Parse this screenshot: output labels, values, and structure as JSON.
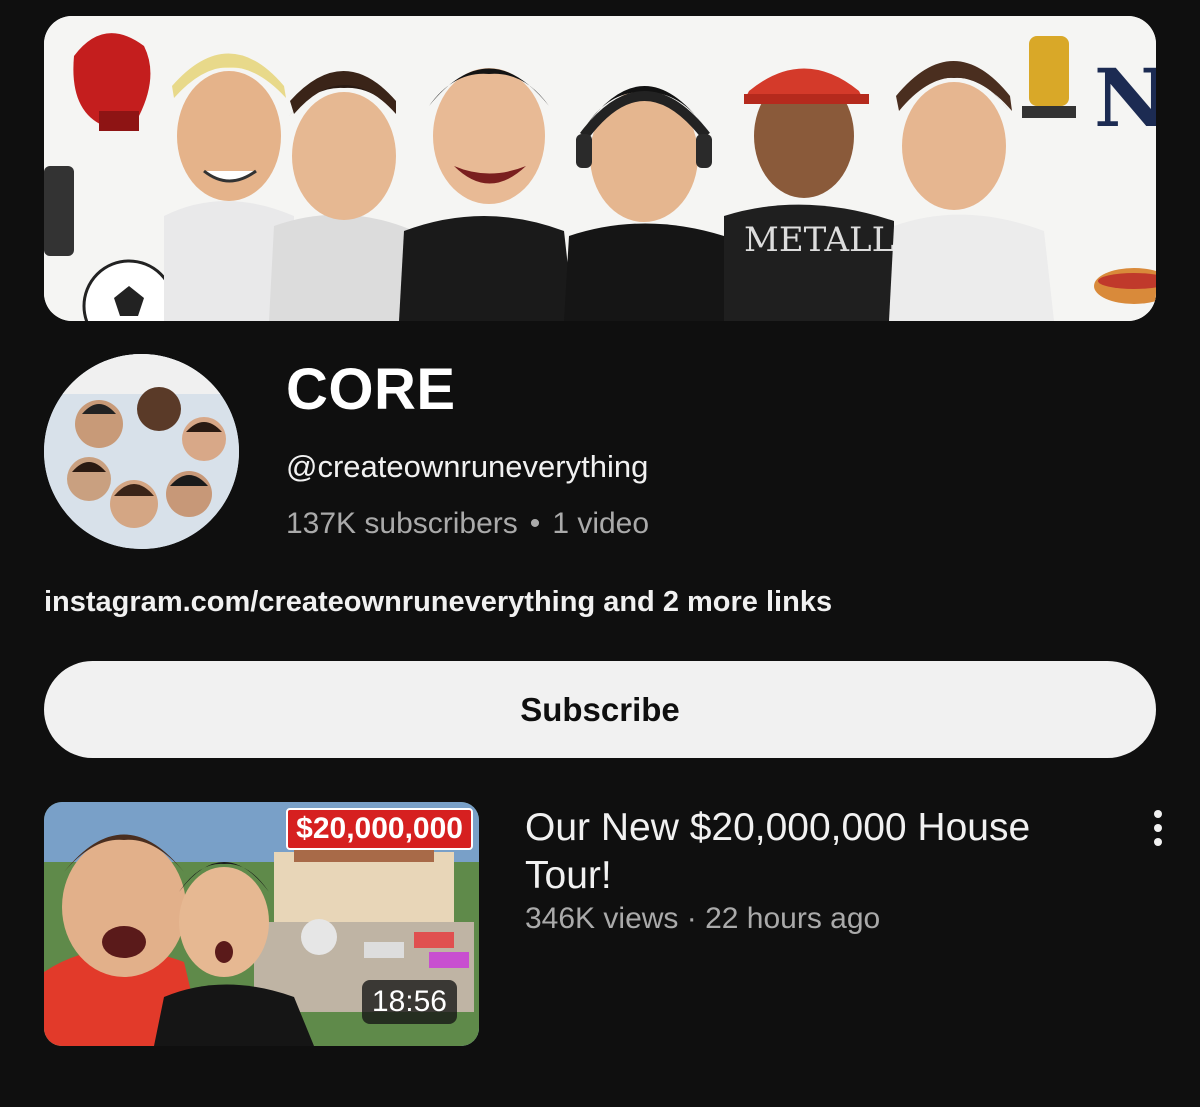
{
  "channel": {
    "name": "CORE",
    "handle": "@createownruneverything",
    "subscribers": "137K subscribers",
    "separator": "•",
    "video_count": "1 video",
    "links_text": "instagram.com/createownruneverything and 2 more links",
    "banner_icon": "channel-banner-art",
    "avatar_icon": "channel-avatar-photo"
  },
  "actions": {
    "subscribe_label": "Subscribe"
  },
  "videos": [
    {
      "title": "Our New $20,000,000 House Tour!",
      "meta": "346K views · 22 hours ago",
      "duration": "18:56",
      "thumbnail_text": "$20,000,000",
      "menu_icon": "more-vert-icon"
    }
  ],
  "colors": {
    "background": "#0f0f0f",
    "primary_text": "#f1f1f1",
    "secondary_text": "#aaaaaa",
    "subscribe_bg": "#f1f1f1",
    "price_tag": "#d62020"
  }
}
